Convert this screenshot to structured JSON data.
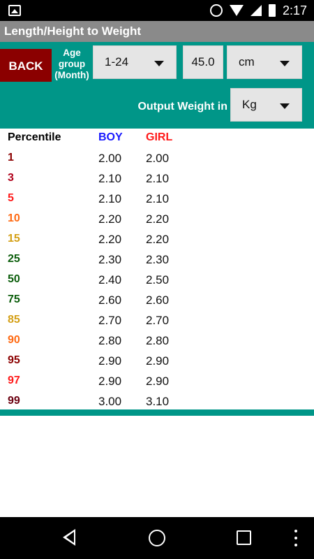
{
  "statusbar": {
    "time": "2:17",
    "icons": [
      "image-icon",
      "alarm-icon",
      "wifi-icon",
      "signal-icon",
      "battery-icon"
    ]
  },
  "app": {
    "title": "Length/Height to Weight"
  },
  "controls": {
    "back_label": "BACK",
    "age_label_line1": "Age",
    "age_label_line2": "group",
    "age_label_line3": "(Month)",
    "age_group_value": "1-24",
    "height_value": "45.0",
    "unit_value": "cm",
    "output_label": "Output Weight in",
    "output_unit_value": "Kg"
  },
  "colors": {
    "accent": "#009688",
    "back_button": "#8b0000",
    "title_bar": "#8a8a8a",
    "boy": "#1a1aff",
    "girl": "#ff1a1a"
  },
  "table": {
    "headers": {
      "percentile": "Percentile",
      "boy": "BOY",
      "girl": "GIRL"
    },
    "rows": [
      {
        "percentile": "1",
        "boy": "2.00",
        "girl": "2.00",
        "color": "#8b0000"
      },
      {
        "percentile": "3",
        "boy": "2.10",
        "girl": "2.10",
        "color": "#b0001a"
      },
      {
        "percentile": "5",
        "boy": "2.10",
        "girl": "2.10",
        "color": "#ff1a1a"
      },
      {
        "percentile": "10",
        "boy": "2.20",
        "girl": "2.20",
        "color": "#ff6a13"
      },
      {
        "percentile": "15",
        "boy": "2.20",
        "girl": "2.20",
        "color": "#d4a017"
      },
      {
        "percentile": "25",
        "boy": "2.30",
        "girl": "2.30",
        "color": "#0b5d0b"
      },
      {
        "percentile": "50",
        "boy": "2.40",
        "girl": "2.50",
        "color": "#0b5d0b"
      },
      {
        "percentile": "75",
        "boy": "2.60",
        "girl": "2.60",
        "color": "#0b5d0b"
      },
      {
        "percentile": "85",
        "boy": "2.70",
        "girl": "2.70",
        "color": "#d4a017"
      },
      {
        "percentile": "90",
        "boy": "2.80",
        "girl": "2.80",
        "color": "#ff6a13"
      },
      {
        "percentile": "95",
        "boy": "2.90",
        "girl": "2.90",
        "color": "#8b0000"
      },
      {
        "percentile": "97",
        "boy": "2.90",
        "girl": "2.90",
        "color": "#ff1a1a"
      },
      {
        "percentile": "99",
        "boy": "3.00",
        "girl": "3.10",
        "color": "#6b0010"
      }
    ]
  },
  "navbar": {
    "icons": [
      "back-icon",
      "home-icon",
      "recents-icon",
      "overflow-menu-icon"
    ]
  }
}
